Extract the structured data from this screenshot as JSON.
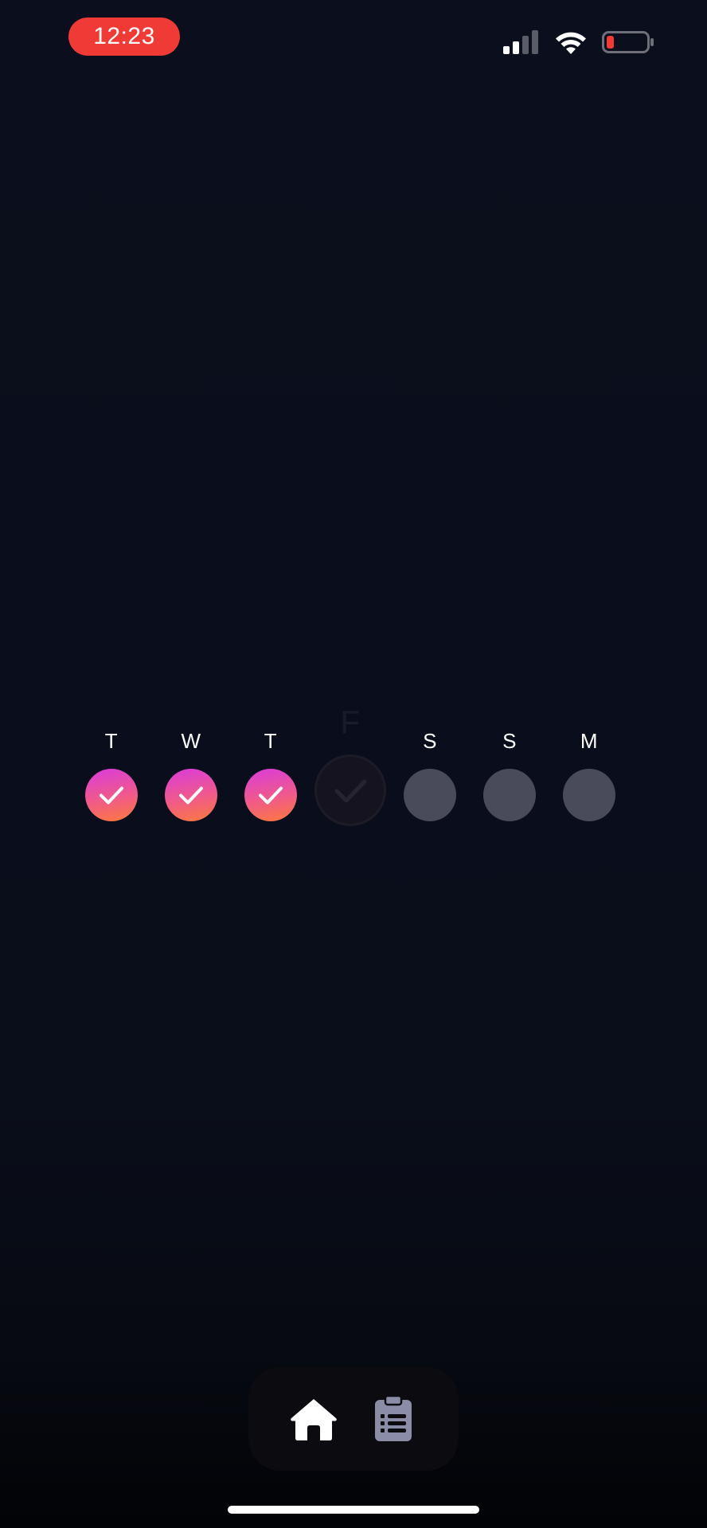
{
  "status_bar": {
    "time": "12:23",
    "time_pill_color": "#f03a36",
    "signal_icon": "cellular-signal-icon",
    "wifi_icon": "wifi-icon",
    "battery_icon": "battery-low-icon"
  },
  "habit_week": {
    "days": [
      {
        "letter": "T",
        "state": "done"
      },
      {
        "letter": "W",
        "state": "done"
      },
      {
        "letter": "T",
        "state": "done"
      },
      {
        "letter": "F",
        "state": "current"
      },
      {
        "letter": "S",
        "state": "pending"
      },
      {
        "letter": "S",
        "state": "pending"
      },
      {
        "letter": "M",
        "state": "pending"
      }
    ],
    "done_gradient": [
      "#d93cdb",
      "#fb7a3c"
    ],
    "pending_color": "#4a4b5a"
  },
  "bottom_nav": {
    "items": [
      {
        "icon": "home-icon",
        "active": true
      },
      {
        "icon": "clipboard-list-icon",
        "active": false
      }
    ],
    "active_color": "#ffffff",
    "inactive_color": "#8b8ca6"
  }
}
